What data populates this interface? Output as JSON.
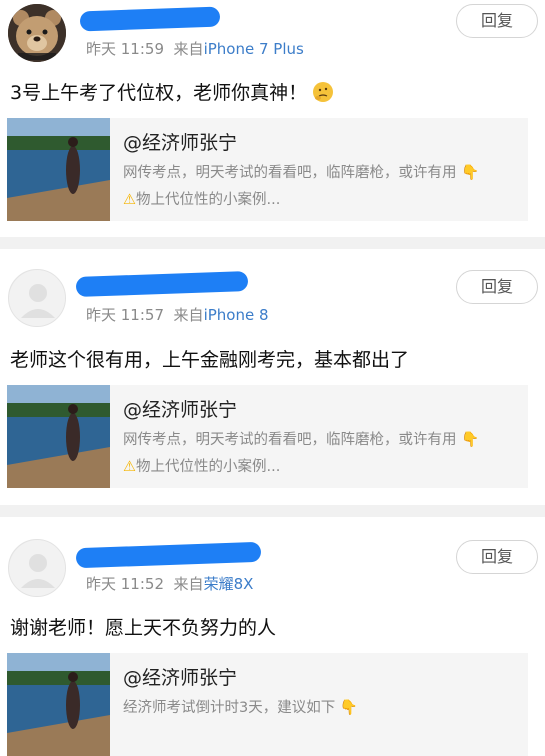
{
  "comments": [
    {
      "time": "昨天 11:59",
      "source_prefix": "来自",
      "source": "iPhone 7 Plus",
      "reply_label": "回复",
      "text": "3号上午考了代位权，老师你真神！",
      "emoji": "thinking-emoji",
      "share": {
        "title": "@经济师张宁",
        "line1": "网传考点，明天考试的看看吧，临阵磨枪，或许有用",
        "line1_icon": "pointing-down-icon",
        "line2": "物上代位性的小案例...",
        "line2_icon": "warning-icon"
      }
    },
    {
      "time": "昨天 11:57",
      "source_prefix": "来自",
      "source": "iPhone 8",
      "reply_label": "回复",
      "text": "老师这个很有用，上午金融刚考完，基本都出了",
      "share": {
        "title": "@经济师张宁",
        "line1": "网传考点，明天考试的看看吧，临阵磨枪，或许有用",
        "line1_icon": "pointing-down-icon",
        "line2": "物上代位性的小案例...",
        "line2_icon": "warning-icon"
      }
    },
    {
      "time": "昨天 11:52",
      "source_prefix": "来自",
      "source": "荣耀8X",
      "reply_label": "回复",
      "text": "谢谢老师！愿上天不负努力的人",
      "share": {
        "title": "@经济师张宁",
        "line1": "经济师考试倒计时3天，建议如下",
        "line1_icon": "pointing-down-icon"
      }
    }
  ],
  "colors": {
    "name_redaction": "#1e7ff5",
    "source_link": "#3c7dc9",
    "meta_gray": "#8a8a8a",
    "divider": "#f1f1f1",
    "share_bg": "#f5f5f5"
  }
}
